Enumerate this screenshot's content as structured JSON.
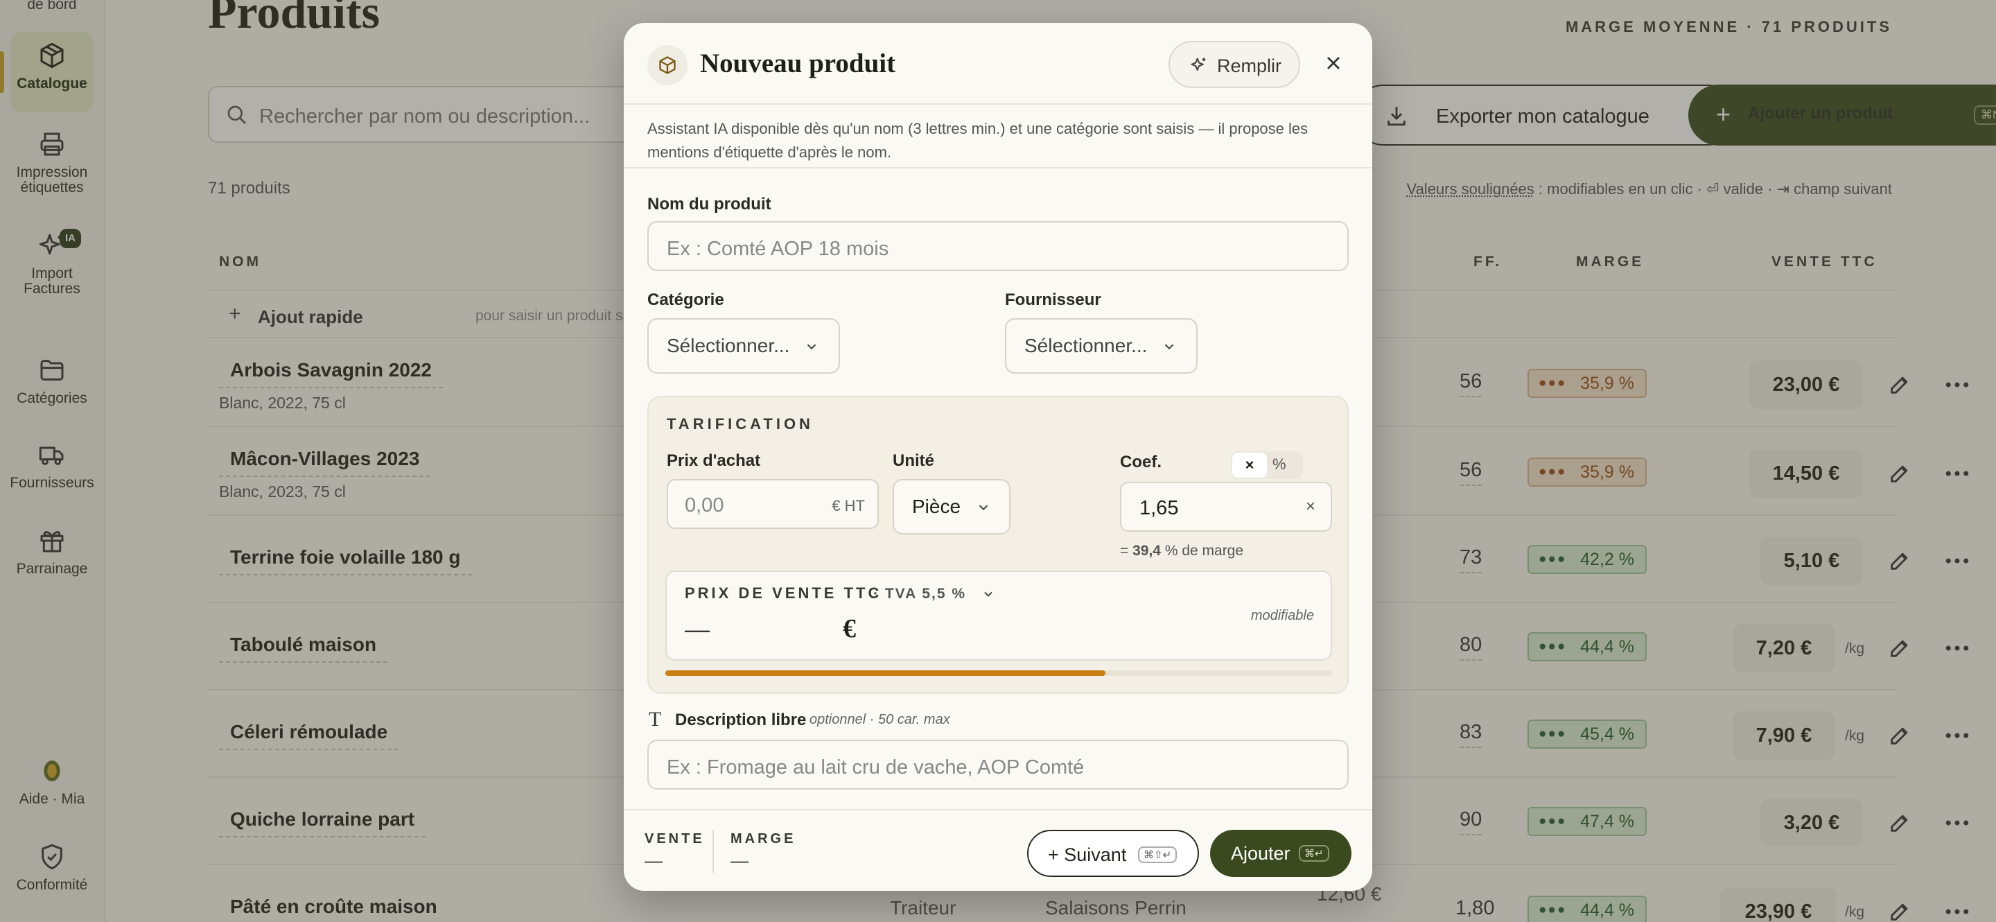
{
  "sidebar": {
    "top_partial": "de bord",
    "items": [
      {
        "label": "Catalogue",
        "icon": "box-icon"
      },
      {
        "label": "Impression\nétiquettes",
        "icon": "printer-icon"
      },
      {
        "label": "Import\nFactures",
        "icon": "sparkle-icon",
        "badge": "IA"
      },
      {
        "label": "Catégories",
        "icon": "folder-icon"
      },
      {
        "label": "Fournisseurs",
        "icon": "truck-icon"
      },
      {
        "label": "Parrainage",
        "icon": "gift-icon"
      },
      {
        "label": "Aide · Mia",
        "icon": "avatar-icon"
      },
      {
        "label": "Conformité",
        "icon": "shield-check-icon"
      }
    ]
  },
  "page": {
    "title": "Produits",
    "stat_title": "MARGE MOYENNE · 71 PRODUITS",
    "search_placeholder": "Rechercher par nom ou description...",
    "export_label": "Exporter mon catalogue",
    "add_label": "Ajouter un produit",
    "add_shortcut": "⌘N",
    "count": "71 produits",
    "hint_underlined": "Valeurs soulignées",
    "hint_rest": " : modifiables en un clic · ⏎ valide · ⇥ champ suivant"
  },
  "table": {
    "headers": {
      "nom": "NOM",
      "coef": "FF.",
      "marge": "MARGE",
      "vente": "VENTE TTC"
    },
    "quick_add": {
      "label": "Ajout rapide",
      "sub": "pour saisir un produit sans ouvrir le fo"
    },
    "rows": [
      {
        "name": "Arbois Savagnin 2022",
        "detail": "Blanc, 2022, 75 cl",
        "coef": "56",
        "marge": "35,9 %",
        "level": "warn",
        "price": "23,00 €",
        "unit": ""
      },
      {
        "name": "Mâcon-Villages 2023",
        "detail": "Blanc, 2023, 75 cl",
        "coef": "56",
        "marge": "35,9 %",
        "level": "warn",
        "price": "14,50 €",
        "unit": ""
      },
      {
        "name": "Terrine foie volaille 180 g",
        "detail": "",
        "coef": "73",
        "marge": "42,2 %",
        "level": "ok",
        "price": "5,10 €",
        "unit": ""
      },
      {
        "name": "Taboulé maison",
        "detail": "",
        "coef": "80",
        "marge": "44,4 %",
        "level": "ok",
        "price": "7,20 €",
        "unit": "/kg"
      },
      {
        "name": "Céleri rémoulade",
        "detail": "",
        "coef": "83",
        "marge": "45,4 %",
        "level": "ok",
        "price": "7,90 €",
        "unit": "/kg"
      },
      {
        "name": "Quiche lorraine part",
        "detail": "",
        "coef": "90",
        "marge": "47,4 %",
        "level": "ok",
        "price": "3,20 €",
        "unit": ""
      },
      {
        "name": "Pâté en croûte maison",
        "detail": "",
        "coef": "1,80",
        "marge": "44,4 %",
        "level": "ok",
        "price": "23,90 €",
        "unit": "/kg",
        "category": "Traiteur",
        "supplier": "Salaisons Perrin",
        "purchase": "12,60 €"
      }
    ]
  },
  "modal": {
    "title": "Nouveau produit",
    "fill_label": "Remplir",
    "info": "Assistant IA disponible dès qu'un nom (3 lettres min.) et une catégorie sont saisis — il propose les mentions d'étiquette d'après le nom.",
    "name_label": "Nom du produit",
    "name_placeholder": "Ex : Comté AOP 18 mois",
    "category_label": "Catégorie",
    "category_value": "Sélectionner...",
    "supplier_label": "Fournisseur",
    "supplier_value": "Sélectionner...",
    "pricing": {
      "section": "TARIFICATION",
      "purchase_label": "Prix d'achat",
      "purchase_placeholder": "0,00",
      "purchase_suffix": "€ HT",
      "unit_label": "Unité",
      "unit_value": "Pièce",
      "coef_label": "Coef.",
      "toggle_x": "×",
      "toggle_pct": "%",
      "coef_value": "1,65",
      "coef_clear": "×",
      "margin_prefix": "= ",
      "margin_value": "39,4",
      "margin_suffix": " % de marge",
      "sale_label": "PRIX DE VENTE TTC",
      "tva_label": "· TVA 5,5 %",
      "sale_value": "—",
      "currency": "€",
      "modifiable": "modifiable",
      "progress": 0.66
    },
    "description": {
      "label": "Description libre",
      "hint": "optionnel · 50 car. max",
      "placeholder": "Ex : Fromage au lait cru de vache, AOP Comté"
    },
    "footer": {
      "vente_label": "VENTE",
      "vente_value": "—",
      "marge_label": "MARGE",
      "marge_value": "—",
      "next_label": "+ Suivant",
      "next_shortcut": "⌘⇧↵",
      "add_label": "Ajouter",
      "add_shortcut": "⌘↵"
    }
  }
}
